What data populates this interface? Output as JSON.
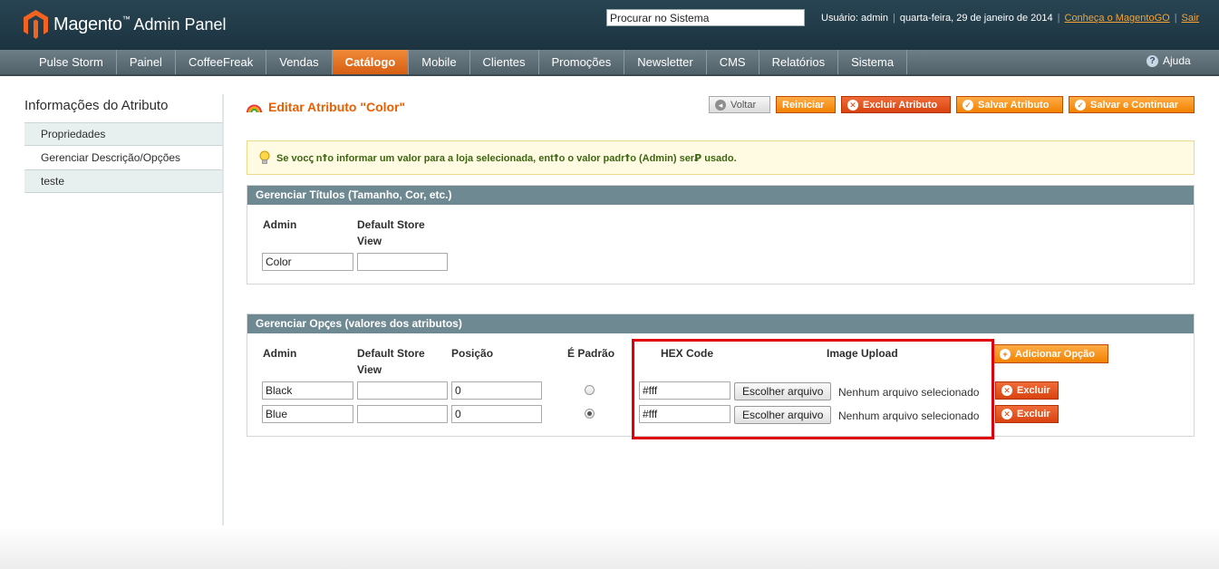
{
  "header": {
    "logo_text": "Magento",
    "logo_sub": "Admin Panel",
    "search_value": "Procurar no Sistema",
    "user_label": "Usuário: admin",
    "date": "quarta-feira, 29 de janeiro de 2014",
    "link_magentogo": "Conheça o MagentoGO",
    "link_logout": "Sair"
  },
  "nav": {
    "items": [
      "Pulse Storm",
      "Painel",
      "CoffeeFreak",
      "Vendas",
      "Catálogo",
      "Mobile",
      "Clientes",
      "Promoções",
      "Newsletter",
      "CMS",
      "Relatórios",
      "Sistema"
    ],
    "active": "Catálogo",
    "help_label": "Ajuda"
  },
  "sidebar": {
    "title": "Informações do Atributo",
    "items": [
      "Propriedades",
      "Gerenciar Descrição/Opções",
      "teste"
    ],
    "active": "Gerenciar Descrição/Opções"
  },
  "page": {
    "title": "Editar Atributo \"Color\"",
    "buttons": {
      "back": "Voltar",
      "reset": "Reiniciar",
      "delete": "Excluir Atributo",
      "save": "Salvar Atributo",
      "save_continue": "Salvar e Continuar"
    },
    "notice": "Se vocꞔ nꝉo informar um valor para a loja selecionada, entꝉo o valor padrꝉo (Admin) serꝐ usado."
  },
  "titles_box": {
    "header": "Gerenciar Títulos (Tamanho, Cor, etc.)",
    "col_admin": "Admin",
    "col_store_line1": "Default Store",
    "col_store_line2": "View",
    "admin_value": "Color",
    "store_value": ""
  },
  "options_box": {
    "header": "Gerenciar Opꞔes (valores dos atributos)",
    "col_admin": "Admin",
    "col_store_line1": "Default Store",
    "col_store_line2": "View",
    "col_position": "Posição",
    "col_default": "É Padrão",
    "col_hex": "HEX Code",
    "col_image": "Image Upload",
    "add_button": "Adicionar Opção",
    "file_button": "Escolher arquivo",
    "no_file": "Nenhum arquivo selecionado",
    "delete_label": "Excluir",
    "rows": [
      {
        "admin": "Black",
        "store": "",
        "position": "0",
        "default": false,
        "hex": "#fff"
      },
      {
        "admin": "Blue",
        "store": "",
        "position": "0",
        "default": true,
        "hex": "#fff"
      }
    ]
  }
}
